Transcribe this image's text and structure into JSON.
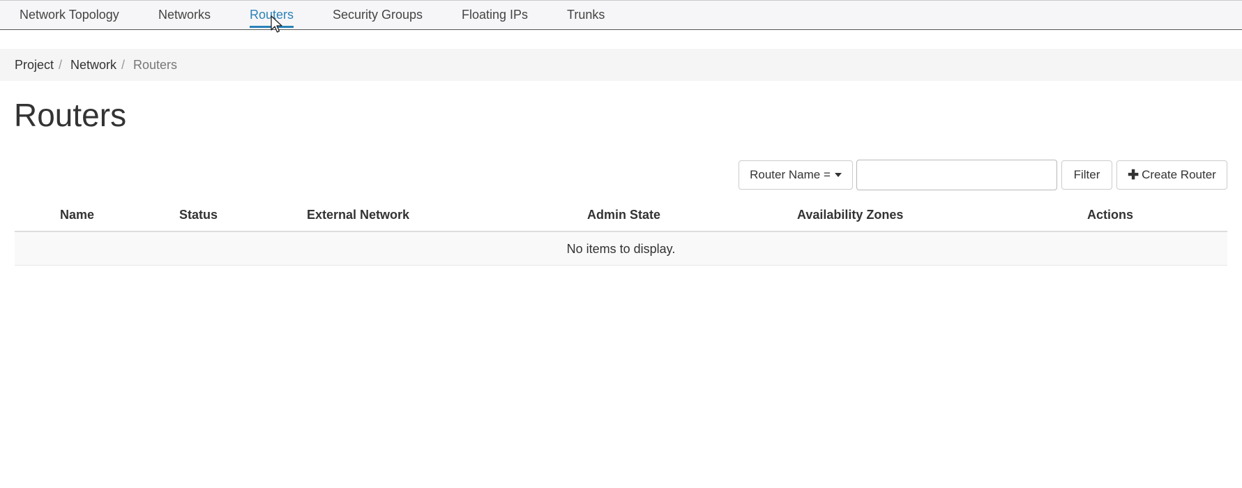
{
  "tabs": [
    {
      "label": "Network Topology",
      "active": false
    },
    {
      "label": "Networks",
      "active": false
    },
    {
      "label": "Routers",
      "active": true
    },
    {
      "label": "Security Groups",
      "active": false
    },
    {
      "label": "Floating IPs",
      "active": false
    },
    {
      "label": "Trunks",
      "active": false
    }
  ],
  "breadcrumb": {
    "items": [
      "Project",
      "Network",
      "Routers"
    ],
    "separator": "/"
  },
  "page": {
    "title": "Routers"
  },
  "toolbar": {
    "filter_field_label": "Router Name =",
    "filter_value": "",
    "filter_button_label": "Filter",
    "create_button_label": "Create Router"
  },
  "table": {
    "columns": [
      "Name",
      "Status",
      "External Network",
      "Admin State",
      "Availability Zones",
      "Actions"
    ],
    "rows": [],
    "empty_message": "No items to display."
  },
  "colors": {
    "accent": "#2a82b8",
    "text": "#333333",
    "breadcrumb_bg": "#f5f5f6",
    "nav_bg": "#f6f6f8"
  }
}
